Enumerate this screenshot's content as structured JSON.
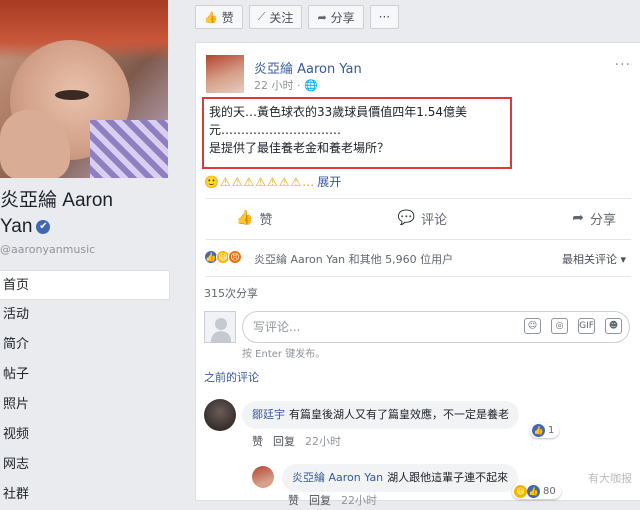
{
  "profile": {
    "name_line1": "炎亞綸 Aaron",
    "name_line2": "Yan",
    "verified_glyph": "✔",
    "handle": "@aaronyanmusic"
  },
  "nav": {
    "items": [
      {
        "label": "首页",
        "active": true
      },
      {
        "label": "活动"
      },
      {
        "label": "简介"
      },
      {
        "label": "帖子"
      },
      {
        "label": "照片"
      },
      {
        "label": "视频"
      },
      {
        "label": "网志"
      },
      {
        "label": "社群"
      }
    ]
  },
  "actions": {
    "like": "赞",
    "follow": "关注",
    "share": "分享",
    "more": "···"
  },
  "post": {
    "author": "炎亞綸 Aaron Yan",
    "time": "22 小时",
    "text_line1": "我的天…黃色球衣的33歲球員價值四年1.54億美",
    "text_line2": "元…………………………",
    "text_line3": "是提供了最佳養老金和養老場所？",
    "emojis": "🙂⚠⚠⚠⚠⚠⚠⚠…",
    "expand": "展开",
    "more": "···"
  },
  "reactions": {
    "like": "赞",
    "comment": "评论",
    "share": "分享"
  },
  "likes": {
    "text": "炎亞綸 Aaron Yan 和其他 5,960 位用户",
    "sort": "最相关评论 ▾"
  },
  "shares": "315次分享",
  "comment_box": {
    "placeholder": "写评论...",
    "hint": "按 Enter 键发布。"
  },
  "previous_comments": "之前的评论",
  "comments": [
    {
      "author": "鄒廷宇",
      "text": "有篇皇後湖人又有了篇皇效應，不一定是養老",
      "like": "赞",
      "reply": "回复",
      "time": "22小时",
      "likes": "1"
    }
  ],
  "reply": {
    "author": "炎亞綸 Aaron Yan",
    "text": "湖人跟他這輩子連不起來",
    "like": "赞",
    "reply": "回复",
    "time": "22小时",
    "likes": "80"
  },
  "watermark": "有大咖报",
  "colors": {
    "link": "#365899",
    "highlight_border": "#d93a3a",
    "background": "#e9ebee"
  }
}
